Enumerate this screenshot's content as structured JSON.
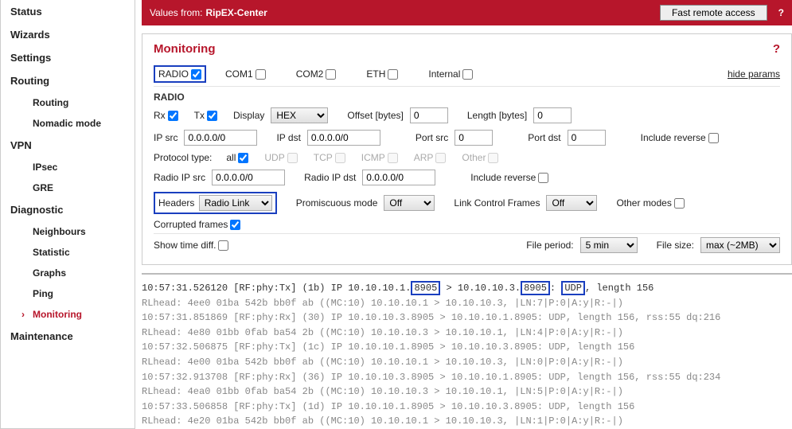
{
  "sidebar": {
    "status": "Status",
    "wizards": "Wizards",
    "settings": "Settings",
    "routing": "Routing",
    "routing_sub": "Routing",
    "nomadic": "Nomadic mode",
    "vpn": "VPN",
    "ipsec": "IPsec",
    "gre": "GRE",
    "diagnostic": "Diagnostic",
    "neighbours": "Neighbours",
    "statistic": "Statistic",
    "graphs": "Graphs",
    "ping": "Ping",
    "monitoring": "Monitoring",
    "maintenance": "Maintenance"
  },
  "topbar": {
    "label": "Values from:",
    "source": "RipEX-Center",
    "fast": "Fast remote access",
    "q": "?"
  },
  "panel": {
    "title": "Monitoring",
    "q": "?",
    "hide_params": "hide params"
  },
  "filters": {
    "radio": "RADIO",
    "com1": "COM1",
    "com2": "COM2",
    "eth": "ETH",
    "internal": "Internal"
  },
  "radio_section": {
    "heading": "RADIO",
    "rx": "Rx",
    "tx": "Tx",
    "display": "Display",
    "display_val": "HEX",
    "offset": "Offset [bytes]",
    "offset_val": "0",
    "length": "Length [bytes]",
    "length_val": "0",
    "ipsrc": "IP src",
    "ipsrc_val": "0.0.0.0/0",
    "ipdst": "IP dst",
    "ipdst_val": "0.0.0.0/0",
    "portsrc": "Port src",
    "portsrc_val": "0",
    "portdst": "Port dst",
    "portdst_val": "0",
    "inc_rev": "Include reverse",
    "protocol": "Protocol type:",
    "all": "all",
    "udp": "UDP",
    "tcp": "TCP",
    "icmp": "ICMP",
    "arp": "ARP",
    "other": "Other",
    "ripsrc": "Radio IP src",
    "ripsrc_val": "0.0.0.0/0",
    "ripdst": "Radio IP dst",
    "ripdst_val": "0.0.0.0/0",
    "headers": "Headers",
    "headers_val": "Radio Link",
    "promisc": "Promiscuous mode",
    "promisc_val": "Off",
    "linkctrl": "Link Control Frames",
    "linkctrl_val": "Off",
    "othermodes": "Other modes",
    "corrupted": "Corrupted frames",
    "showtime": "Show time diff.",
    "fileperiod": "File period:",
    "fileperiod_val": "5 min",
    "filesize": "File size:",
    "filesize_val": "max (~2MB)"
  },
  "log": {
    "l1a": "10:57:31.526120 [RF:phy:Tx] (1b) IP 10.10.10.1.",
    "l1b": "8905",
    "l1c": " > 10.10.10.3.",
    "l1d": "8905",
    "l1e": ": ",
    "l1f": "UDP",
    "l1g": ", length 156",
    "l2": "  RLhead:  4ee0 01ba 542b bb0f ab ((MC:10) 10.10.10.1 > 10.10.10.3, |LN:7|P:0|A:y|R:-|)",
    "l3": "10:57:31.851869 [RF:phy:Rx] (30) IP 10.10.10.3.8905 > 10.10.10.1.8905: UDP, length 156, rss:55 dq:216",
    "l4": "  RLhead:  4e80 01bb 0fab ba54 2b ((MC:10) 10.10.10.3 > 10.10.10.1, |LN:4|P:0|A:y|R:-|)",
    "l5": "10:57:32.506875 [RF:phy:Tx] (1c) IP 10.10.10.1.8905 > 10.10.10.3.8905: UDP, length 156",
    "l6": "  RLhead:  4e00 01ba 542b bb0f ab ((MC:10) 10.10.10.1 > 10.10.10.3, |LN:0|P:0|A:y|R:-|)",
    "l7": "10:57:32.913708 [RF:phy:Rx] (36) IP 10.10.10.3.8905 > 10.10.10.1.8905: UDP, length 156, rss:55 dq:234",
    "l8": "  RLhead:  4ea0 01bb 0fab ba54 2b ((MC:10) 10.10.10.3 > 10.10.10.1, |LN:5|P:0|A:y|R:-|)",
    "l9": "10:57:33.506858 [RF:phy:Tx] (1d) IP 10.10.10.1.8905 > 10.10.10.3.8905: UDP, length 156",
    "l10": "  RLhead:  4e20 01ba 542b bb0f ab ((MC:10) 10.10.10.1 > 10.10.10.3, |LN:1|P:0|A:y|R:-|)"
  }
}
